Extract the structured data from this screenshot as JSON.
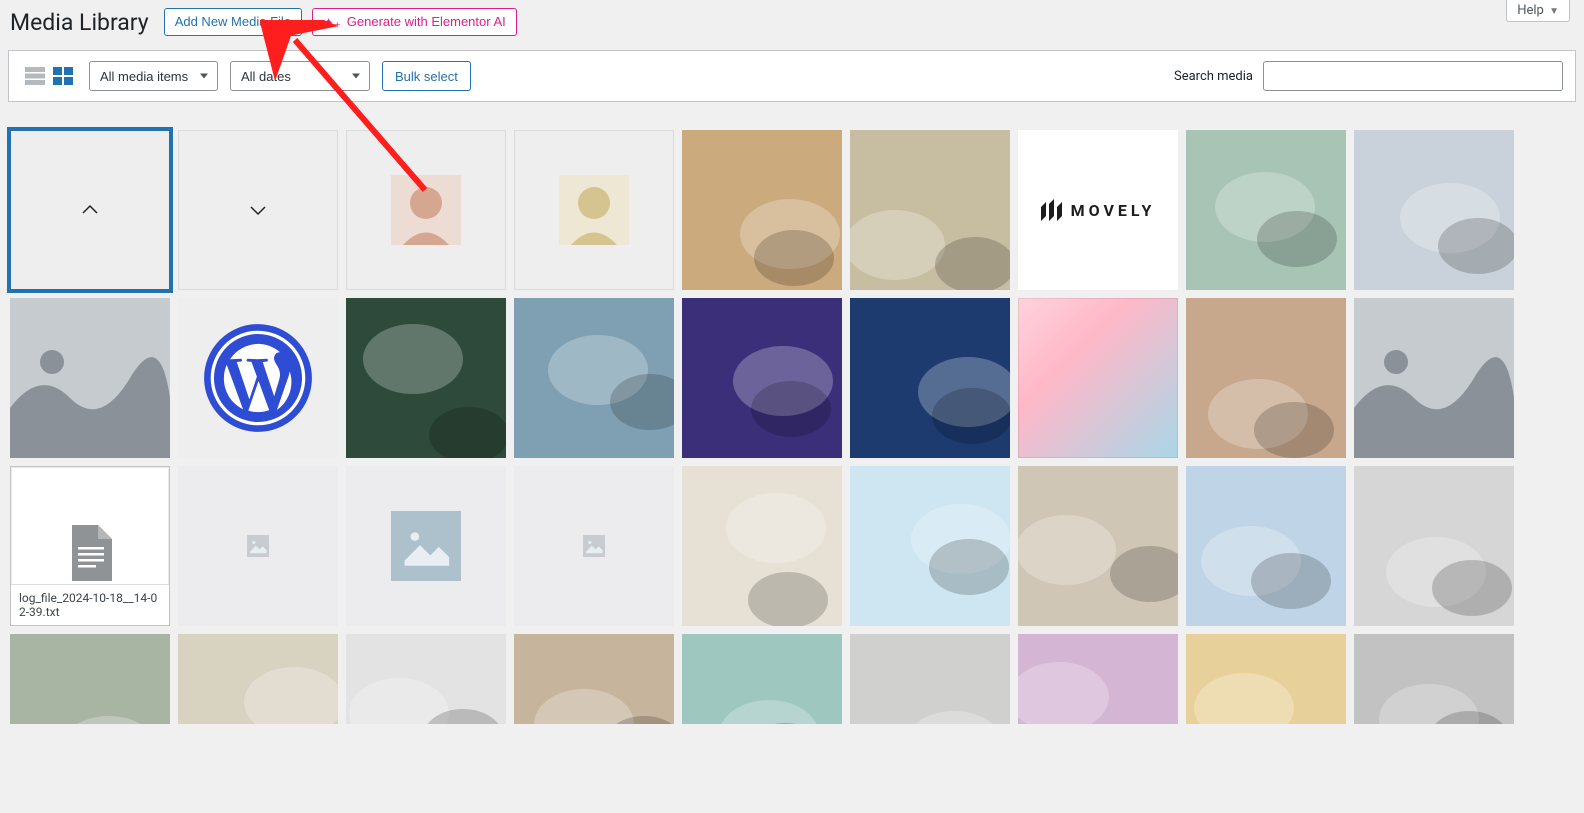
{
  "header": {
    "title": "Media Library",
    "add_new_label": "Add New Media File",
    "generate_ai_label": "Generate with Elementor AI",
    "help_label": "Help"
  },
  "toolbar": {
    "view_list_label": "List view",
    "view_grid_label": "Grid view",
    "filter_type": {
      "selected": "All media items"
    },
    "filter_date": {
      "selected": "All dates"
    },
    "bulk_select_label": "Bulk select",
    "search_label": "Search media",
    "search_placeholder": ""
  },
  "media": {
    "file_item_name": "log_file_2024-10-18__14-02-39.txt",
    "movely_text": "MOVELY",
    "items": [
      {
        "kind": "icon-chevron-up",
        "selected": true
      },
      {
        "kind": "icon-chevron-down"
      },
      {
        "kind": "face-1"
      },
      {
        "kind": "face-2"
      },
      {
        "kind": "photo",
        "bg": "#CBAA7D"
      },
      {
        "kind": "photo",
        "bg": "#C7BEA2"
      },
      {
        "kind": "movely"
      },
      {
        "kind": "photo",
        "bg": "#A8C4B5"
      },
      {
        "kind": "photo",
        "bg": "#C9D2DA"
      },
      {
        "kind": "placeholder-wave"
      },
      {
        "kind": "wordpress"
      },
      {
        "kind": "photo",
        "bg": "#2E4A3A"
      },
      {
        "kind": "photo",
        "bg": "#7FA0B2"
      },
      {
        "kind": "photo",
        "bg": "#3C2F7A"
      },
      {
        "kind": "photo",
        "bg": "#1D3B6F"
      },
      {
        "kind": "gradient"
      },
      {
        "kind": "photo",
        "bg": "#C7A88C"
      },
      {
        "kind": "placeholder-wave"
      },
      {
        "kind": "file"
      },
      {
        "kind": "placeholder-img-tiny"
      },
      {
        "kind": "placeholder-img-med"
      },
      {
        "kind": "placeholder-img-tiny"
      },
      {
        "kind": "photo",
        "bg": "#E6E1D4"
      },
      {
        "kind": "photo",
        "bg": "#CDE6F2"
      },
      {
        "kind": "photo",
        "bg": "#D0C6B5"
      },
      {
        "kind": "photo",
        "bg": "#BFD4E6"
      },
      {
        "kind": "photo",
        "bg": "#D6D6D6"
      },
      {
        "kind": "photo",
        "bg": "#A8B5A2",
        "partial": true
      },
      {
        "kind": "photo",
        "bg": "#D8D2C0",
        "partial": true
      },
      {
        "kind": "photo",
        "bg": "#E3E3E3",
        "partial": true
      },
      {
        "kind": "photo",
        "bg": "#C7B49C",
        "partial": true
      },
      {
        "kind": "photo",
        "bg": "#9EC7C0",
        "partial": true
      },
      {
        "kind": "photo",
        "bg": "#D0D0CE",
        "partial": true
      },
      {
        "kind": "photo",
        "bg": "#D4B5D4",
        "partial": true
      },
      {
        "kind": "photo",
        "bg": "#E8D09A",
        "partial": true
      },
      {
        "kind": "photo",
        "bg": "#C2C2C2",
        "partial": true
      }
    ]
  },
  "colors": {
    "primary": "#2271b1",
    "accent": "#e11d8b",
    "annotation": "#ff1e1e"
  }
}
